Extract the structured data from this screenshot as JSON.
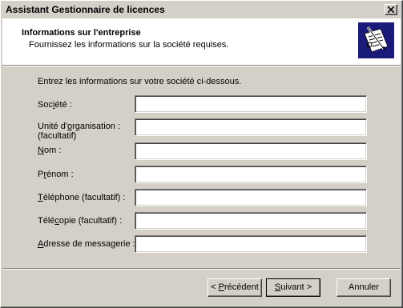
{
  "window": {
    "title": "Assistant Gestionnaire de licences"
  },
  "header": {
    "title": "Informations sur l'entreprise",
    "subtitle": "Fournissez les informations sur la société requises.",
    "icon": "license-document-pen-icon"
  },
  "form": {
    "intro": "Entrez les informations sur votre société ci-dessous.",
    "fields": [
      {
        "label_pre": "Soc",
        "label_mnemonic": "i",
        "label_post": "été :",
        "value": ""
      },
      {
        "label_pre": "Unité d'",
        "label_mnemonic": "o",
        "label_post": "rganisation :",
        "label_line2": "(facultatif)",
        "value": ""
      },
      {
        "label_pre": "",
        "label_mnemonic": "N",
        "label_post": "om :",
        "value": ""
      },
      {
        "label_pre": "P",
        "label_mnemonic": "r",
        "label_post": "énom :",
        "value": ""
      },
      {
        "label_pre": "",
        "label_mnemonic": "T",
        "label_post": "éléphone (facultatif) :",
        "value": ""
      },
      {
        "label_pre": "Télé",
        "label_mnemonic": "c",
        "label_post": "opie (facultatif) :",
        "value": ""
      },
      {
        "label_pre": "",
        "label_mnemonic": "A",
        "label_post": "dresse de messagerie :",
        "value": ""
      }
    ]
  },
  "buttons": {
    "back_pre": "< ",
    "back_mnemonic": "P",
    "back_post": "récédent",
    "next_pre": "",
    "next_mnemonic": "S",
    "next_post": "uivant >",
    "cancel": "Annuler"
  }
}
